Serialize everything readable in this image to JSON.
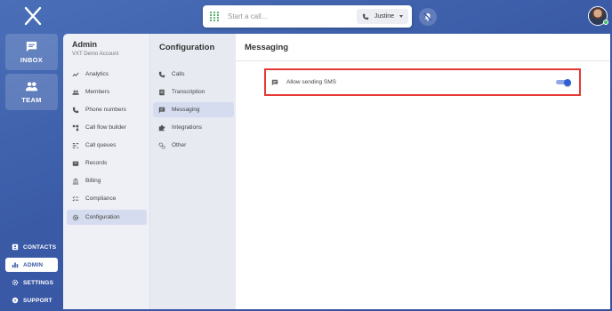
{
  "app": {
    "logo_icon": "x-logo",
    "accent_color": "#3a5aa6"
  },
  "topbar": {
    "call_placeholder": "Start a call...",
    "caller_name": "Justine",
    "dialpad_icon": "dialpad-icon",
    "bell_icon": "bell-off-icon"
  },
  "rail": {
    "inbox_label": "INBOX",
    "team_label": "TEAM",
    "contacts_label": "CONTACTS",
    "admin_label": "ADMIN",
    "settings_label": "SETTINGS",
    "support_label": "SUPPORT"
  },
  "admin": {
    "title": "Admin",
    "subtitle": "VXT Demo Account",
    "items": [
      {
        "label": "Analytics",
        "icon": "analytics-icon"
      },
      {
        "label": "Members",
        "icon": "members-icon"
      },
      {
        "label": "Phone numbers",
        "icon": "phone-icon"
      },
      {
        "label": "Call flow builder",
        "icon": "call-flow-icon"
      },
      {
        "label": "Call queues",
        "icon": "call-queues-icon"
      },
      {
        "label": "Records",
        "icon": "records-icon"
      },
      {
        "label": "Billing",
        "icon": "billing-icon"
      },
      {
        "label": "Compliance",
        "icon": "compliance-icon"
      },
      {
        "label": "Configuration",
        "icon": "gear-icon"
      }
    ]
  },
  "config": {
    "title": "Configuration",
    "items": [
      {
        "label": "Calls",
        "icon": "phone-icon"
      },
      {
        "label": "Transcription",
        "icon": "transcription-icon"
      },
      {
        "label": "Messaging",
        "icon": "message-icon"
      },
      {
        "label": "Integrations",
        "icon": "puzzle-icon"
      },
      {
        "label": "Other",
        "icon": "other-icon"
      }
    ]
  },
  "main": {
    "title": "Messaging",
    "setting_label": "Allow sending SMS",
    "setting_enabled": true,
    "toggle_color": "#2f5fd6"
  }
}
